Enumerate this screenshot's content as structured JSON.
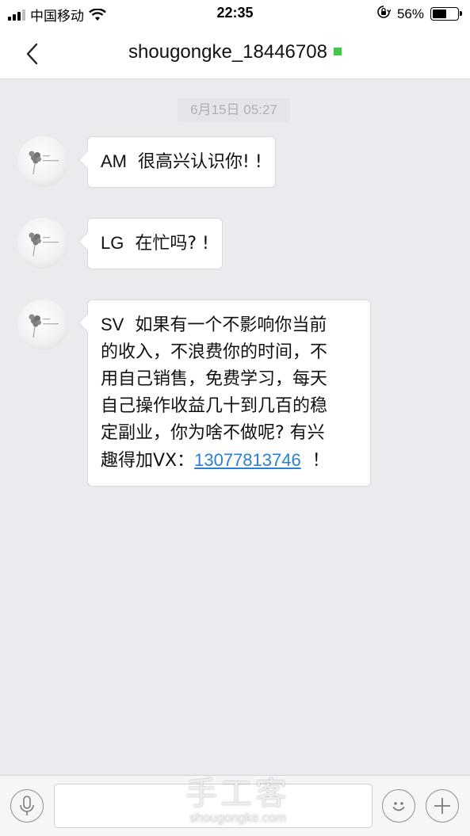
{
  "status_bar": {
    "carrier": "中国移动",
    "time": "22:35",
    "battery_percent": "56%",
    "battery_level": 0.56,
    "icons": [
      "signal-icon",
      "wifi-icon",
      "orientation-lock-icon",
      "battery-icon"
    ]
  },
  "nav": {
    "back_icon": "chevron-left-icon",
    "title": "shougongke_18446708",
    "online_color": "#3ccc48"
  },
  "chat": {
    "timestamp": "6月15日 05:27",
    "messages": [
      {
        "prefix": "AM",
        "text": "很高兴认识你! !"
      },
      {
        "prefix": "LG",
        "text": "在忙吗? !"
      },
      {
        "prefix": "SV",
        "lines": [
          "如果有一个不影响你当前",
          "的收入，不浪费你的时间，不",
          "用自己销售，免费学习，每天",
          "自己操作收益几十到几百的稳",
          "定副业，你为啥不做呢? 有兴"
        ],
        "last_line_before_link": "趣得加VX：",
        "phone": "13077813746",
        "after_link": "！"
      }
    ]
  },
  "input_bar": {
    "placeholder": "",
    "icons": [
      "microphone-icon",
      "emoji-icon",
      "plus-icon"
    ],
    "watermark_main": "手工客",
    "watermark_sub": "shougongke.com"
  },
  "colors": {
    "link": "#2a7fd4",
    "background": "#ebebef",
    "bubble": "#ffffff"
  }
}
